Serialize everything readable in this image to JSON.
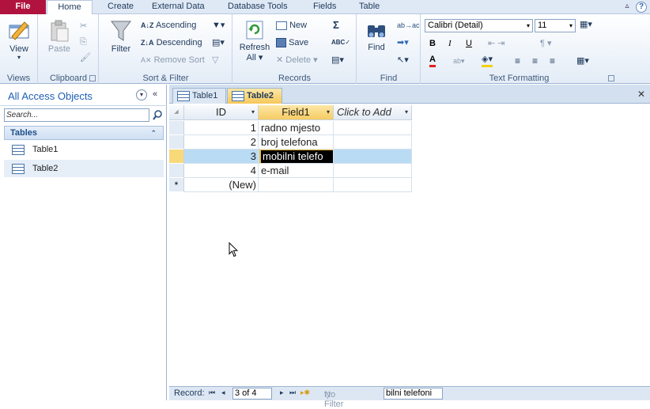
{
  "ribbon_tabs": [
    {
      "label": "File"
    },
    {
      "label": "Home"
    },
    {
      "label": "Create"
    },
    {
      "label": "External Data"
    },
    {
      "label": "Database Tools"
    },
    {
      "label": "Fields"
    },
    {
      "label": "Table"
    }
  ],
  "groups": {
    "views": {
      "label": "Views",
      "view_btn": "View"
    },
    "clipboard": {
      "label": "Clipboard",
      "paste_btn": "Paste"
    },
    "sort_filter": {
      "label": "Sort & Filter",
      "filter_btn": "Filter",
      "ascending": "Ascending",
      "descending": "Descending",
      "remove_sort": "Remove Sort"
    },
    "records": {
      "label": "Records",
      "refresh_btn_line1": "Refresh",
      "refresh_btn_line2": "All",
      "new": "New",
      "save": "Save",
      "delete": "Delete"
    },
    "find": {
      "label": "Find",
      "find_btn": "Find"
    },
    "text_formatting": {
      "label": "Text Formatting",
      "font_name": "Calibri (Detail)",
      "font_size": "11",
      "bold": "B",
      "italic": "I",
      "underline": "U"
    }
  },
  "nav_pane": {
    "title": "All Access Objects",
    "search_placeholder": "Search...",
    "section": "Tables",
    "items": [
      {
        "label": "Table1"
      },
      {
        "label": "Table2"
      }
    ]
  },
  "doc_tabs": [
    {
      "label": "Table1"
    },
    {
      "label": "Table2"
    }
  ],
  "datasheet": {
    "columns": [
      "ID",
      "Field1",
      "Click to Add"
    ],
    "rows": [
      {
        "id": "1",
        "field1": "radno mjesto"
      },
      {
        "id": "2",
        "field1": "broj telefona"
      },
      {
        "id": "3",
        "field1": "mobilni telefo"
      },
      {
        "id": "4",
        "field1": "e-mail"
      }
    ],
    "new_row_marker": "*",
    "new_row_label": "(New)"
  },
  "status": {
    "record_label": "Record:",
    "record_value": "3 of 4",
    "no_filter": "No Filter",
    "search_text": "bilni telefoni"
  }
}
